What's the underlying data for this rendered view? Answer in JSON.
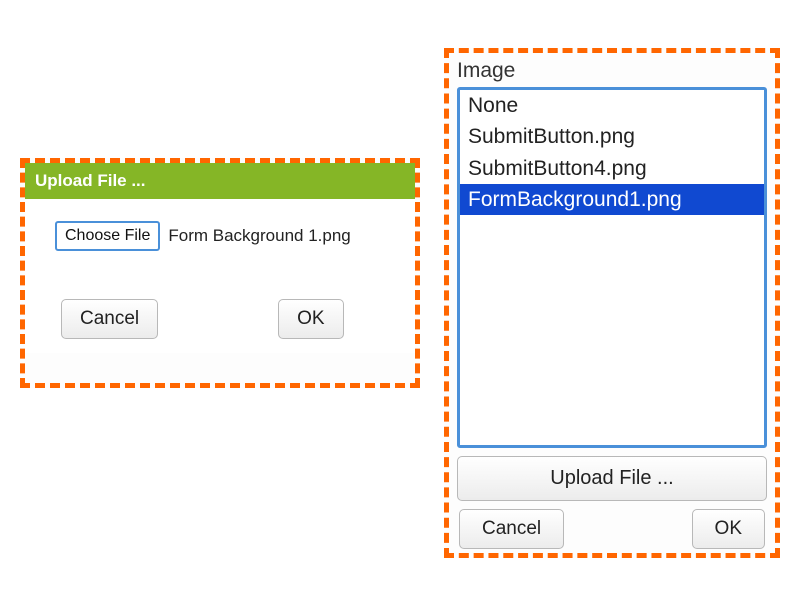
{
  "uploadDialog": {
    "title": "Upload File ...",
    "chooseFileLabel": "Choose File",
    "selectedFileName": "Form Background 1.png",
    "cancelLabel": "Cancel",
    "okLabel": "OK"
  },
  "imageDialog": {
    "label": "Image",
    "items": [
      {
        "label": "None",
        "selected": false
      },
      {
        "label": "SubmitButton.png",
        "selected": false
      },
      {
        "label": "SubmitButton4.png",
        "selected": false
      },
      {
        "label": "FormBackground1.png",
        "selected": true
      }
    ],
    "uploadButtonLabel": "Upload File ...",
    "cancelLabel": "Cancel",
    "okLabel": "OK"
  }
}
